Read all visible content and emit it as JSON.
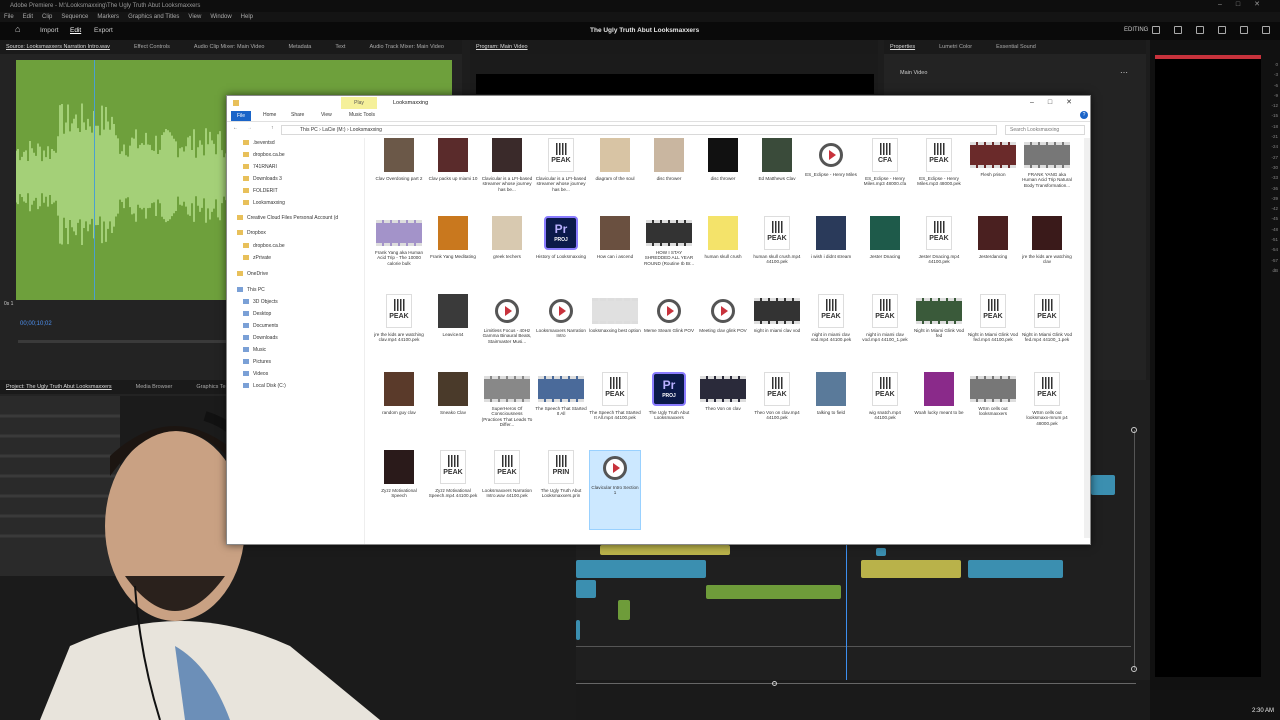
{
  "app_title": "Adobe Premiere - M:\\Looksmaxxing\\The Ugly Truth Abut Looksmaxxers",
  "menus": [
    "File",
    "Edit",
    "Clip",
    "Sequence",
    "Markers",
    "Graphics and Titles",
    "View",
    "Window",
    "Help"
  ],
  "workspaces": [
    "Import",
    "Edit",
    "Export"
  ],
  "doc_title": "The Ugly Truth Abut Looksmaxxers",
  "editing_label": "EDITING",
  "source_tabs": [
    "Source: Looksmaxxers Narration Intro.wav",
    "Effect Controls",
    "Audio Clip Mixer: Main Video",
    "Metadata",
    "Text",
    "Audio Track Mixer: Main Video"
  ],
  "program_tab": "Program: Main Video",
  "prop_tabs": [
    "Properties",
    "Lumetri Color",
    "Essential Sound"
  ],
  "prop_item": "Main Video",
  "source_timecode": "00;00;10;02",
  "project_tabs": [
    "Project: The Ugly Truth Abut Looksmaxxers",
    "Media Browser",
    "Graphics Templ"
  ],
  "clock": "2:30 AM",
  "meter_scale": [
    "0",
    "-3",
    "-6",
    "-9",
    "-12",
    "-15",
    "-18",
    "-21",
    "-24",
    "-27",
    "-30",
    "-33",
    "-36",
    "-39",
    "-42",
    "-45",
    "-48",
    "-51",
    "-54",
    "-57",
    "dB"
  ],
  "explorer": {
    "title": "Looksmaxxing",
    "play_tab": "Play",
    "ribbon_tabs": [
      "File",
      "Home",
      "Share",
      "View",
      "Music Tools"
    ],
    "address": "This PC  ›  LaCie (M:)  ›  Looksmaxxing",
    "search_placeholder": "Search Looksmaxxing",
    "nav": [
      ".beventsd",
      "dropbox.ca.be",
      "741RNARI",
      "Downloads 3",
      "FOLDERIT",
      "Looksmaxxing",
      "Creative Cloud Files Personal Account (d",
      "Dropbox",
      "dropbox.ca.be",
      "zPrivate",
      "OneDrive",
      "This PC",
      "3D Objects",
      "Desktop",
      "Documents",
      "Downloads",
      "Music",
      "Pictures",
      "Videos",
      "Local Disk (C:)"
    ],
    "files": [
      {
        "name": "Clav Overdosing part 2",
        "kind": "img",
        "color": "#6b5848"
      },
      {
        "name": "Clav packs up miami 10",
        "kind": "img",
        "color": "#5a2b2b"
      },
      {
        "name": "Clavicular is a LFI-based streamer whose journey has be...",
        "kind": "img",
        "color": "#3a2a2a"
      },
      {
        "name": "Clavicular is a LFI-based streamer whose journey has be...",
        "kind": "peak"
      },
      {
        "name": "diagram of the soul",
        "kind": "img",
        "color": "#d8c4a4"
      },
      {
        "name": "disc thrower",
        "kind": "img",
        "color": "#c9b6a0"
      },
      {
        "name": "disc thrower",
        "kind": "img",
        "color": "#111"
      },
      {
        "name": "Ed Matthews Clav",
        "kind": "img",
        "color": "#3a4b3a"
      },
      {
        "name": "ES_Eclipse - Henry Miles",
        "kind": "vid"
      },
      {
        "name": "ES_Eclipse - Henry Miles.mp3 48000.cfa",
        "kind": "cfa"
      },
      {
        "name": "ES_Eclipse - Henry Miles.mp3 48000.pek",
        "kind": "peak"
      },
      {
        "name": "Flesh prison",
        "kind": "film",
        "color": "#6a2a2a"
      },
      {
        "name": "FRANK YANG aka Human Acid Trip Natural Body Transformation...",
        "kind": "film",
        "color": "#777"
      },
      {
        "name": "Frank Yang aka Human Acid Trip - The 10000 calorie bulk",
        "kind": "film",
        "color": "#a393c9"
      },
      {
        "name": "Frank Yang Meditating",
        "kind": "img",
        "color": "#c9781e"
      },
      {
        "name": "greek techers",
        "kind": "img",
        "color": "#d8c9b0"
      },
      {
        "name": "History of Looksmaxxing",
        "kind": "pr"
      },
      {
        "name": "How can i ascend",
        "kind": "img",
        "color": "#6a5040"
      },
      {
        "name": "HOW I STAY SHREDDED ALL YEAR ROUND (Routine Ib Br...",
        "kind": "film",
        "color": "#333"
      },
      {
        "name": "human skull crush",
        "kind": "img",
        "color": "#f4e36a"
      },
      {
        "name": "human skull crush.mp4 44100.pek",
        "kind": "peak"
      },
      {
        "name": "i wish i didnt stream",
        "kind": "img",
        "color": "#2a3a5a"
      },
      {
        "name": "Jester Dnacing",
        "kind": "img",
        "color": "#1e5a4a"
      },
      {
        "name": "Jester Dnacing.mp4 44100.pek",
        "kind": "peak"
      },
      {
        "name": "Jesterdancing",
        "kind": "img",
        "color": "#4a2020"
      },
      {
        "name": "jre the kids are watching clav",
        "kind": "img",
        "color": "#3a1a1a"
      },
      {
        "name": "jre the kids are watching clav.mp4 44100.pek",
        "kind": "peak"
      },
      {
        "name": "Leavice44",
        "kind": "img",
        "color": "#3a3a3a"
      },
      {
        "name": "Limitless Focus - 40Hz Gamma Binaural Beats, Stairmaster Musi...",
        "kind": "vid"
      },
      {
        "name": "Looksmaxxers Narration Intro",
        "kind": "vid"
      },
      {
        "name": "looksmaxxing best option",
        "kind": "film",
        "color": "#e0e0e0"
      },
      {
        "name": "Meme Steam Glink POV",
        "kind": "vid"
      },
      {
        "name": "Meeting clav glink POV",
        "kind": "vid"
      },
      {
        "name": "night in miami clav vod",
        "kind": "film",
        "color": "#333"
      },
      {
        "name": "night in miami clav vod.mp4 44100.pek",
        "kind": "peak"
      },
      {
        "name": "night in miami clav vod.mp4 44100_1.pek",
        "kind": "peak"
      },
      {
        "name": "Night in Miami Glink Vod fed",
        "kind": "film",
        "color": "#3a5a3a"
      },
      {
        "name": "Night in Miami Glink Vod fed.mp4 44100.pek",
        "kind": "peak"
      },
      {
        "name": "Night in Miami Glink Vod fed.mp4 44100_1.pek",
        "kind": "peak"
      },
      {
        "name": "random guy clav",
        "kind": "img",
        "color": "#5a3a2a"
      },
      {
        "name": "Sneako Clav",
        "kind": "img",
        "color": "#4a3a2a"
      },
      {
        "name": "SuperHeros Of Consciousness (Practices That Leads To Differ...",
        "kind": "film",
        "color": "#888"
      },
      {
        "name": "The Speech That Started It All",
        "kind": "film",
        "color": "#4a6a9a"
      },
      {
        "name": "The Speech That Started It All.mp4 44100.pek",
        "kind": "peak"
      },
      {
        "name": "The Ugly Truth Abut Looksmaxxers",
        "kind": "pr"
      },
      {
        "name": "Theo Von on clav",
        "kind": "film",
        "color": "#2a2a3a"
      },
      {
        "name": "Theo Von on clav.mp4 44100.pek",
        "kind": "peak"
      },
      {
        "name": "talking to field",
        "kind": "img",
        "color": "#5a7a9a"
      },
      {
        "name": "wig snatch.mp4 44100.pek",
        "kind": "peak"
      },
      {
        "name": "Woah lucky meant to be",
        "kind": "img",
        "color": "#8a2a8a"
      },
      {
        "name": "WSm cells out looksmaxxers",
        "kind": "film",
        "color": "#777"
      },
      {
        "name": "WSm cells out looksmaxx-mrum p4 48000.pek",
        "kind": "peak"
      },
      {
        "name": "Zyzz Motivational Speech",
        "kind": "img",
        "color": "#2a1a1a"
      },
      {
        "name": "Zyzz Motivational Speech.mp4 44100.pek",
        "kind": "peak"
      },
      {
        "name": "Looksmaxxers Narration Intro.wav 44100.pek",
        "kind": "peak"
      },
      {
        "name": "The Ugly Truth Abut Looksmaxxers.prin",
        "kind": "prin"
      },
      {
        "name": "Clavicular Intro Section 1",
        "kind": "vid",
        "selected": true
      }
    ]
  }
}
